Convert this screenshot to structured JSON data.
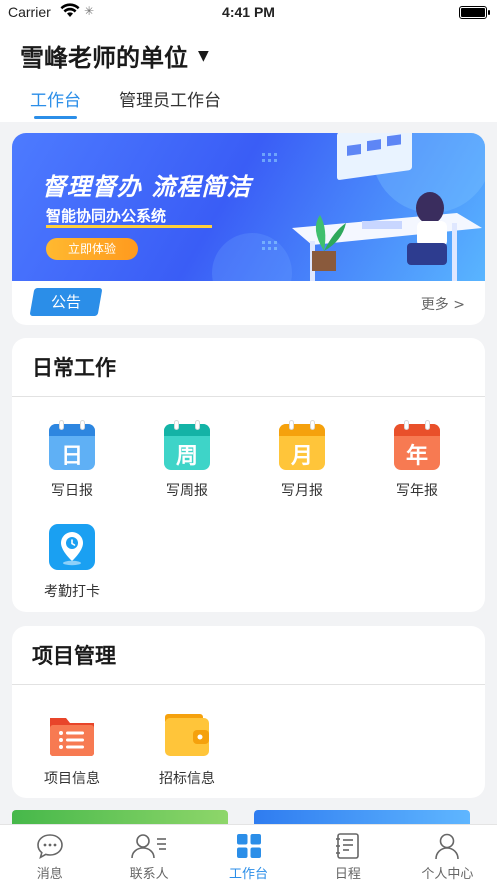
{
  "status_bar": {
    "carrier": "Carrier",
    "time": "4:41 PM"
  },
  "header": {
    "org_title": "雪峰老师的单位",
    "tabs": [
      {
        "label": "工作台",
        "active": true
      },
      {
        "label": "管理员工作台",
        "active": false
      }
    ]
  },
  "banner": {
    "title": "督理督办 流程简洁",
    "subtitle": "智能协同办公系统",
    "button": "立即体验"
  },
  "notice": {
    "badge": "公告",
    "more": "更多 >"
  },
  "daily_work": {
    "title": "日常工作",
    "items": [
      {
        "label": "写日报",
        "glyph": "日",
        "icon": "calendar-day-icon",
        "color": "#3e9bf0"
      },
      {
        "label": "写周报",
        "glyph": "周",
        "icon": "calendar-week-icon",
        "color": "#22c3b8"
      },
      {
        "label": "写月报",
        "glyph": "月",
        "icon": "calendar-month-icon",
        "color": "#ffb21e"
      },
      {
        "label": "写年报",
        "glyph": "年",
        "icon": "calendar-year-icon",
        "color": "#f2603a"
      },
      {
        "label": "考勤打卡",
        "icon": "attendance-location-icon",
        "color": "#1e9bf0"
      }
    ]
  },
  "project_mgmt": {
    "title": "项目管理",
    "items": [
      {
        "label": "项目信息",
        "icon": "folder-list-icon",
        "color": "#f5623c"
      },
      {
        "label": "招标信息",
        "icon": "wallet-icon",
        "color": "#ffb21e"
      }
    ]
  },
  "tabbar": {
    "items": [
      {
        "label": "消息",
        "icon": "chat-bubble-icon",
        "active": false
      },
      {
        "label": "联系人",
        "icon": "contacts-icon",
        "active": false
      },
      {
        "label": "工作台",
        "icon": "grid-icon",
        "active": true
      },
      {
        "label": "日程",
        "icon": "schedule-icon",
        "active": false
      },
      {
        "label": "个人中心",
        "icon": "profile-icon",
        "active": false
      }
    ]
  },
  "colors": {
    "accent": "#2b8ee8"
  }
}
